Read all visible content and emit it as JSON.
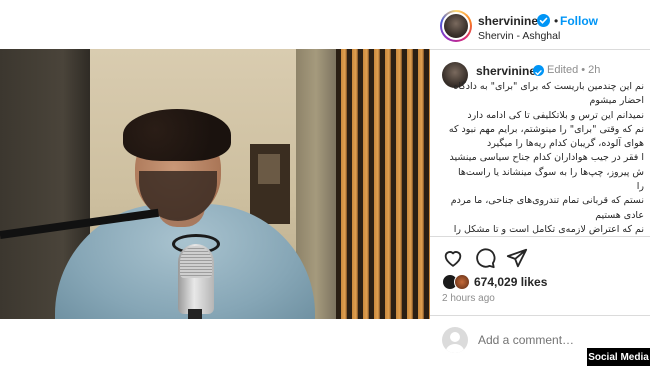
{
  "header": {
    "username": "shervinine",
    "separator": "•",
    "follow_label": "Follow",
    "subtitle": "Shervin - Ashghal"
  },
  "caption": {
    "username": "shervinine",
    "meta": "Edited • 2h",
    "lines": [
      "نم این چندمین باریست که برای \"برای\" به دادگاه",
      "احضار میشوم",
      "نمیدانم این ترس و بلاتکلیفی تا کی ادامه دارد",
      "نم که وقتی \"برای\" را مینوشتم، برایم مهم نبود که",
      "هوای آلوده، گریبان کدام ریه‌ها را میگیرد",
      "ا فقر در جیب هواداران کدام جناح سیاسی مینشید",
      "ش پیروز، چپ‌ها را به سوگ مینشاند یا راست‌ها",
      "را",
      "نستم که قربانی تمام تندروی‌های جناحی، ما مردم",
      "عادی هستیم",
      "نم که اعتراض لازمه‌ی تکامل است و تا مشکل را"
    ]
  },
  "actions": {
    "like_icon": "heart-outline",
    "comment_icon": "speech-bubble",
    "share_icon": "paper-plane"
  },
  "likes": {
    "text": "674,029 likes"
  },
  "time_ago": "2 hours ago",
  "comment": {
    "placeholder": "Add a comment…"
  },
  "watermark": "Social Media",
  "colors": {
    "accent": "#0095f6",
    "text": "#262626",
    "muted": "#8e8e8e",
    "divider": "#dbdbdb"
  }
}
